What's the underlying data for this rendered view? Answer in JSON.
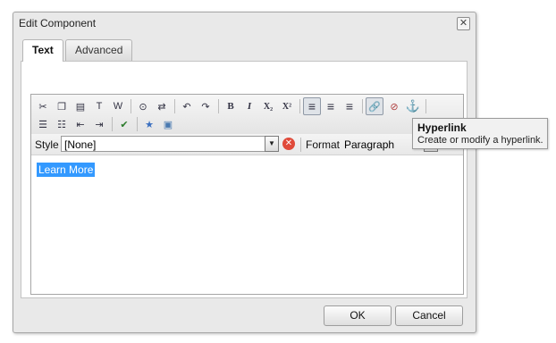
{
  "window": {
    "title": "Edit Component",
    "close_glyph": "✕"
  },
  "tabs": [
    {
      "label": "Text"
    },
    {
      "label": "Advanced"
    }
  ],
  "toolbar": {
    "buttons": [
      {
        "name": "cut-icon",
        "glyph": "✂"
      },
      {
        "name": "copy-icon",
        "glyph": "❐"
      },
      {
        "name": "paste-icon",
        "glyph": "▤"
      },
      {
        "name": "paste-plain-icon",
        "glyph": "T"
      },
      {
        "name": "paste-word-icon",
        "glyph": "W"
      },
      {
        "name": "find-icon",
        "glyph": "⊙"
      },
      {
        "name": "replace-icon",
        "glyph": "⇄"
      },
      {
        "name": "undo-icon",
        "glyph": "↶"
      },
      {
        "name": "redo-icon",
        "glyph": "↷"
      },
      {
        "name": "bold-icon",
        "glyph": "B"
      },
      {
        "name": "italic-icon",
        "glyph": "I"
      },
      {
        "name": "subscript-icon",
        "glyph": "X₂"
      },
      {
        "name": "superscript-icon",
        "glyph": "X²"
      },
      {
        "name": "align-left-icon",
        "glyph": "≡"
      },
      {
        "name": "align-center-icon",
        "glyph": "≡"
      },
      {
        "name": "align-right-icon",
        "glyph": "≡"
      },
      {
        "name": "link-icon",
        "glyph": "🔗"
      },
      {
        "name": "unlink-icon",
        "glyph": "⊘"
      },
      {
        "name": "anchor-icon",
        "glyph": "⚓"
      },
      {
        "name": "bullet-list-icon",
        "glyph": "☰"
      },
      {
        "name": "numbered-list-icon",
        "glyph": "☷"
      },
      {
        "name": "outdent-icon",
        "glyph": "⇤"
      },
      {
        "name": "indent-icon",
        "glyph": "⇥"
      },
      {
        "name": "spellcheck-icon",
        "glyph": "✔"
      },
      {
        "name": "special-chars-icon",
        "glyph": "★"
      },
      {
        "name": "image-icon",
        "glyph": "▣"
      }
    ]
  },
  "style_bar": {
    "style_label": "Style",
    "style_value": "[None]",
    "format_label": "Format",
    "format_value": "Paragraph",
    "dropdown_glyph": "▼",
    "clear_glyph": "✕"
  },
  "editor": {
    "selected_text": "Learn More"
  },
  "tooltip": {
    "title": "Hyperlink",
    "text": "Create or modify a hyperlink."
  },
  "footer": {
    "ok_label": "OK",
    "cancel_label": "Cancel"
  },
  "colors": {
    "selection": "#3399ff",
    "clear_button": "#e04a3a"
  }
}
